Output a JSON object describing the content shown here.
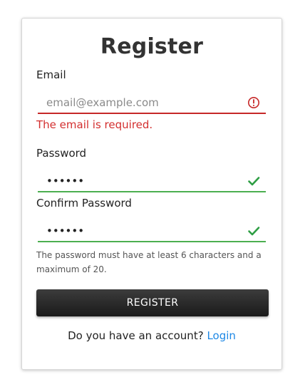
{
  "form": {
    "title": "Register",
    "email": {
      "label": "Email",
      "value": "",
      "placeholder": "email@example.com",
      "error": "The email is required.",
      "state_color": "#c62828"
    },
    "password": {
      "label": "Password",
      "value": "••••••",
      "state_color": "#4caf50"
    },
    "confirm_password": {
      "label": "Confirm Password",
      "value": "••••••",
      "state_color": "#4caf50"
    },
    "password_hint": "The password must have at least 6 characters and a maximum of 20.",
    "submit_label": "REGISTER",
    "footer": {
      "prompt": "Do you have an account?",
      "link_label": "Login",
      "link_color": "#1e88e5"
    },
    "icons": {
      "email_status": "error-circle-icon",
      "password_status": "checkmark-icon",
      "confirm_status": "checkmark-icon"
    }
  }
}
